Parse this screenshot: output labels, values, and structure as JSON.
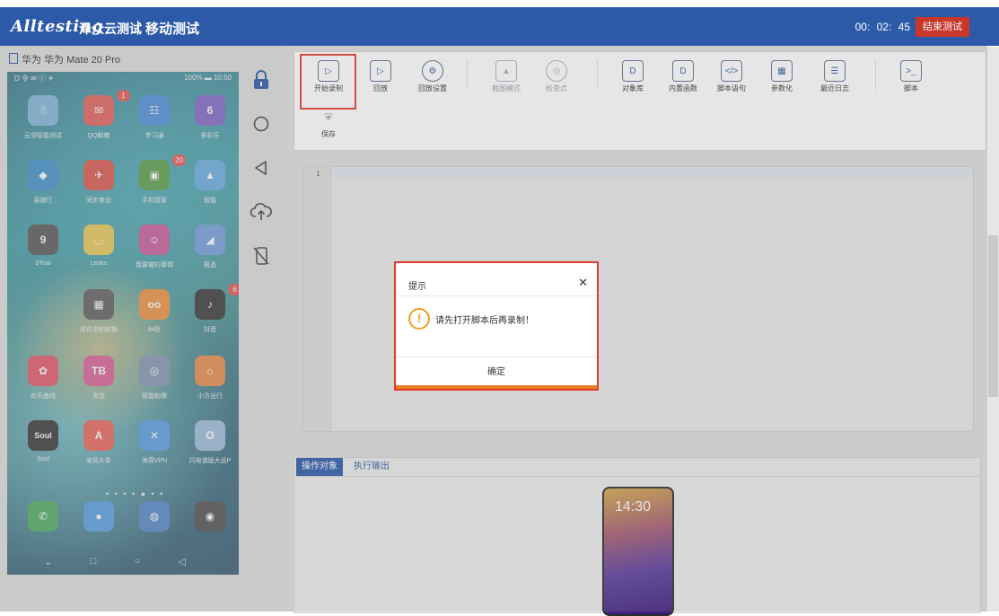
{
  "header": {
    "logo_text": "Alltesting",
    "logo_cn": "泽众云测试",
    "module": "移动测试",
    "timer": "00: 02: 45",
    "end_button": "结束测试"
  },
  "device": {
    "label": "华为 华为 Mate 20 Pro",
    "status_left": "D 令 ✉ ⓒ ✈",
    "status_right": "100% ▬ 10:50",
    "page_dots": "• • • • ● • •",
    "apps": [
      {
        "label": "云领智能测试",
        "color": "#6ba9d8",
        "glyph": "☃"
      },
      {
        "label": "QQ邮箱",
        "color": "#e2453c",
        "glyph": "✉",
        "badge": "1"
      },
      {
        "label": "学习通",
        "color": "#2c7bd6",
        "glyph": "☷"
      },
      {
        "label": "多彩乐",
        "color": "#6a4bc2",
        "glyph": "6"
      },
      {
        "label": "易随行",
        "color": "#1e7fc4",
        "glyph": "◆"
      },
      {
        "label": "同步商业",
        "color": "#d83a2f",
        "glyph": "✈"
      },
      {
        "label": "手机管家",
        "color": "#3c8f2b",
        "glyph": "▣",
        "badge": "20"
      },
      {
        "label": "智能",
        "color": "#4d9fe0",
        "glyph": "▲"
      },
      {
        "label": "9Trial",
        "color": "#3b3b3b",
        "glyph": "9"
      },
      {
        "label": "Leaks",
        "color": "#e8c23a",
        "glyph": "◡"
      },
      {
        "label": "我要做的事情",
        "color": "#c03f8a",
        "glyph": "☺"
      },
      {
        "label": "瓶盖",
        "color": "#5b8fd9",
        "glyph": "◢"
      },
      {
        "label": "成件进制转换",
        "color": "#444444",
        "glyph": "▦"
      },
      {
        "label": "94折",
        "color": "#f0801e",
        "glyph": "oo"
      },
      {
        "label": "抖音",
        "color": "#141414",
        "glyph": "♪",
        "badge": "6"
      },
      {
        "label": "欢乐曲线",
        "color": "#e03a52",
        "glyph": "✿"
      },
      {
        "label": "淘宝",
        "color": "#d64685",
        "glyph": "TB"
      },
      {
        "label": "智能助理",
        "color": "#6e84a8",
        "glyph": "◎"
      },
      {
        "label": "小方出行",
        "color": "#e8772a",
        "glyph": "⌂"
      },
      {
        "label": "Soul",
        "color": "#141414",
        "glyph": "Soul"
      },
      {
        "label": "安风头条",
        "color": "#e94b3c",
        "glyph": "A"
      },
      {
        "label": "海燕VPN",
        "color": "#3a8fe0",
        "glyph": "✕"
      },
      {
        "label": "闪电谱版大运P",
        "color": "#8ab4d8",
        "glyph": "✪"
      },
      {
        "label": "",
        "color": "#2f9e45",
        "glyph": "✆"
      },
      {
        "label": "",
        "color": "#3a8fe0",
        "glyph": "●"
      },
      {
        "label": "",
        "color": "#3574c6",
        "glyph": "◍"
      },
      {
        "label": "",
        "color": "#333333",
        "glyph": "◉"
      }
    ],
    "nav": [
      "⌄",
      "□",
      "○",
      "◁"
    ]
  },
  "toolbar": {
    "start_record": "开始录制",
    "playback": "回放",
    "playback_settings": "回放设置",
    "screenshot_mode": "截图模式",
    "checkpoint": "检查点",
    "object_library": "对象库",
    "builtin_functions": "内置函数",
    "script_statement": "脚本语句",
    "parameterize": "参数化",
    "recent_log": "最近日志",
    "script": "脚本",
    "save": "保存"
  },
  "editor": {
    "line_number": "1"
  },
  "bottom_tabs": {
    "active": "操作对象",
    "inactive": "执行输出"
  },
  "preview": {
    "time": "14:30"
  },
  "dialog": {
    "title": "提示",
    "message": "请先打开脚本后再录制！",
    "ok": "确定"
  },
  "colors": {
    "brand_blue": "#2c5aa8",
    "danger_red": "#c9372c",
    "highlight_red": "#e23b2e",
    "warning_orange": "#f0a020"
  }
}
